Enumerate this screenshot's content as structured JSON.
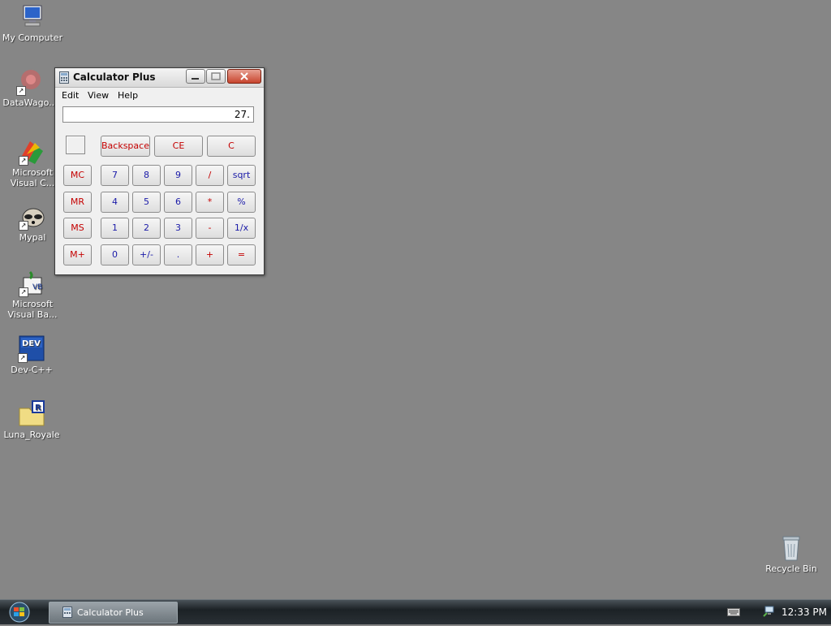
{
  "desktop": {
    "icons": [
      {
        "label": "My Computer",
        "icon": "my-computer-icon"
      },
      {
        "label": "DataWago...",
        "icon": "datawagon-icon"
      },
      {
        "label": "Microsoft Visual C...",
        "icon": "visual-cpp-icon"
      },
      {
        "label": "Mypal",
        "icon": "mypal-icon"
      },
      {
        "label": "Microsoft Visual Ba...",
        "icon": "visual-basic-icon"
      },
      {
        "label": "Dev-C++",
        "icon": "dev-cpp-icon"
      },
      {
        "label": "Luna_Royale",
        "icon": "luna-royale-icon"
      },
      {
        "label": "Recycle Bin",
        "icon": "recycle-bin-icon"
      }
    ]
  },
  "window": {
    "title": "Calculator Plus",
    "menu": [
      "Edit",
      "View",
      "Help"
    ],
    "display_value": "27.",
    "keys": {
      "backspace": "Backspace",
      "ce": "CE",
      "c": "C",
      "mc": "MC",
      "mr": "MR",
      "ms": "MS",
      "mplus": "M+",
      "k7": "7",
      "k8": "8",
      "k9": "9",
      "div": "/",
      "sqrt": "sqrt",
      "k4": "4",
      "k5": "5",
      "k6": "6",
      "mul": "*",
      "pct": "%",
      "k1": "1",
      "k2": "2",
      "k3": "3",
      "sub": "-",
      "inv": "1/x",
      "k0": "0",
      "sign": "+/-",
      "dot": ".",
      "add": "+",
      "eq": "="
    }
  },
  "taskbar": {
    "task_label": "Calculator Plus",
    "clock": "12:33 PM"
  },
  "colors": {
    "desktop": "#868686",
    "key_red": "#c40000",
    "key_blue": "#1a1aa8",
    "close_button": "#c8452e"
  }
}
